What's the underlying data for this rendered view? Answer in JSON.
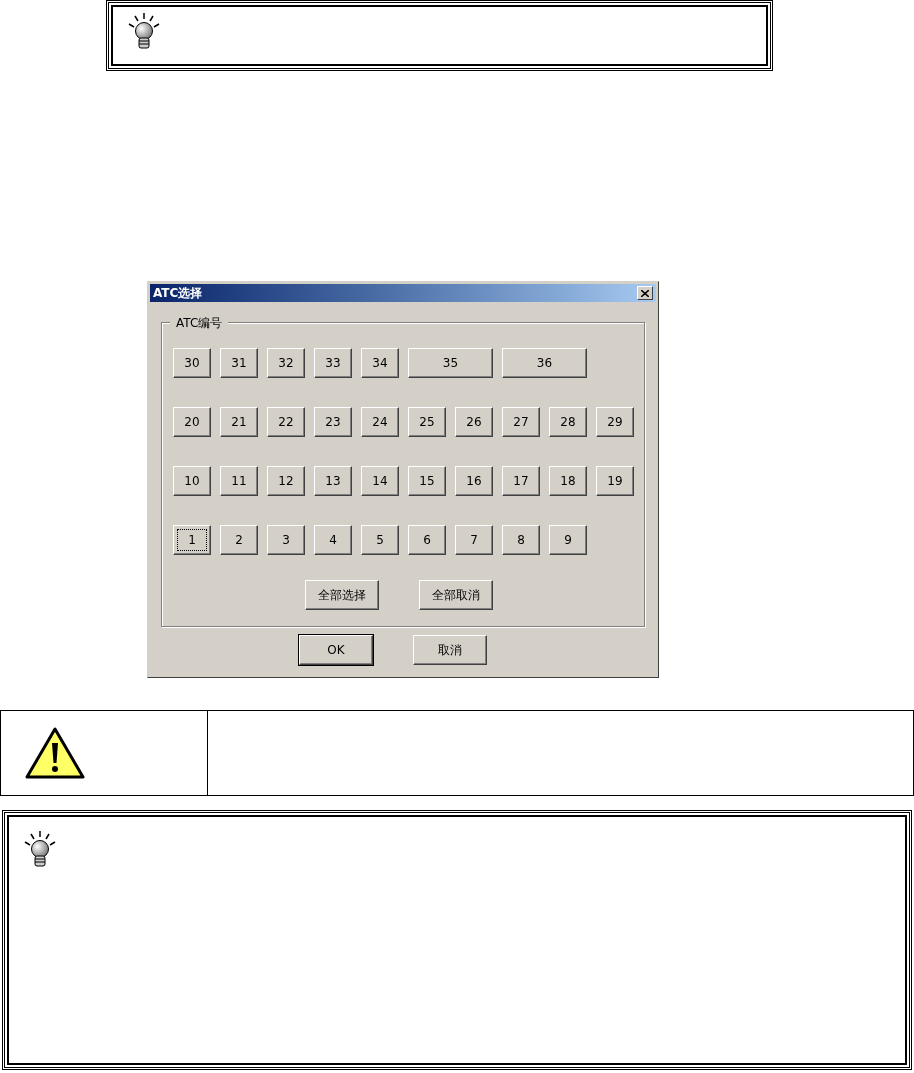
{
  "dialog": {
    "title": "ATC选择",
    "group": {
      "label": "ATC编号",
      "rows": [
        [
          {
            "label": "30",
            "kind": "normal",
            "focused": false
          },
          {
            "label": "31",
            "kind": "normal",
            "focused": false
          },
          {
            "label": "32",
            "kind": "normal",
            "focused": false
          },
          {
            "label": "33",
            "kind": "normal",
            "focused": false
          },
          {
            "label": "34",
            "kind": "normal",
            "focused": false
          },
          {
            "label": "35",
            "kind": "wide",
            "focused": false
          },
          {
            "label": "36",
            "kind": "wide",
            "focused": false
          }
        ],
        [
          {
            "label": "20",
            "kind": "normal",
            "focused": false
          },
          {
            "label": "21",
            "kind": "normal",
            "focused": false
          },
          {
            "label": "22",
            "kind": "normal",
            "focused": false
          },
          {
            "label": "23",
            "kind": "normal",
            "focused": false
          },
          {
            "label": "24",
            "kind": "normal",
            "focused": false
          },
          {
            "label": "25",
            "kind": "normal",
            "focused": false
          },
          {
            "label": "26",
            "kind": "normal",
            "focused": false
          },
          {
            "label": "27",
            "kind": "normal",
            "focused": false
          },
          {
            "label": "28",
            "kind": "normal",
            "focused": false
          },
          {
            "label": "29",
            "kind": "normal",
            "focused": false
          }
        ],
        [
          {
            "label": "10",
            "kind": "normal",
            "focused": false
          },
          {
            "label": "11",
            "kind": "normal",
            "focused": false
          },
          {
            "label": "12",
            "kind": "normal",
            "focused": false
          },
          {
            "label": "13",
            "kind": "normal",
            "focused": false
          },
          {
            "label": "14",
            "kind": "normal",
            "focused": false
          },
          {
            "label": "15",
            "kind": "normal",
            "focused": false
          },
          {
            "label": "16",
            "kind": "normal",
            "focused": false
          },
          {
            "label": "17",
            "kind": "normal",
            "focused": false
          },
          {
            "label": "18",
            "kind": "normal",
            "focused": false
          },
          {
            "label": "19",
            "kind": "normal",
            "focused": false
          }
        ],
        [
          {
            "label": "1",
            "kind": "normal",
            "focused": true
          },
          {
            "label": "2",
            "kind": "normal",
            "focused": false
          },
          {
            "label": "3",
            "kind": "normal",
            "focused": false
          },
          {
            "label": "4",
            "kind": "normal",
            "focused": false
          },
          {
            "label": "5",
            "kind": "normal",
            "focused": false
          },
          {
            "label": "6",
            "kind": "normal",
            "focused": false
          },
          {
            "label": "7",
            "kind": "normal",
            "focused": false
          },
          {
            "label": "8",
            "kind": "normal",
            "focused": false
          },
          {
            "label": "9",
            "kind": "normal",
            "focused": false
          }
        ]
      ],
      "actions": [
        "全部选择",
        "全部取消"
      ]
    },
    "buttons": [
      {
        "label": "OK",
        "default": true
      },
      {
        "label": "取消",
        "default": false
      }
    ]
  }
}
